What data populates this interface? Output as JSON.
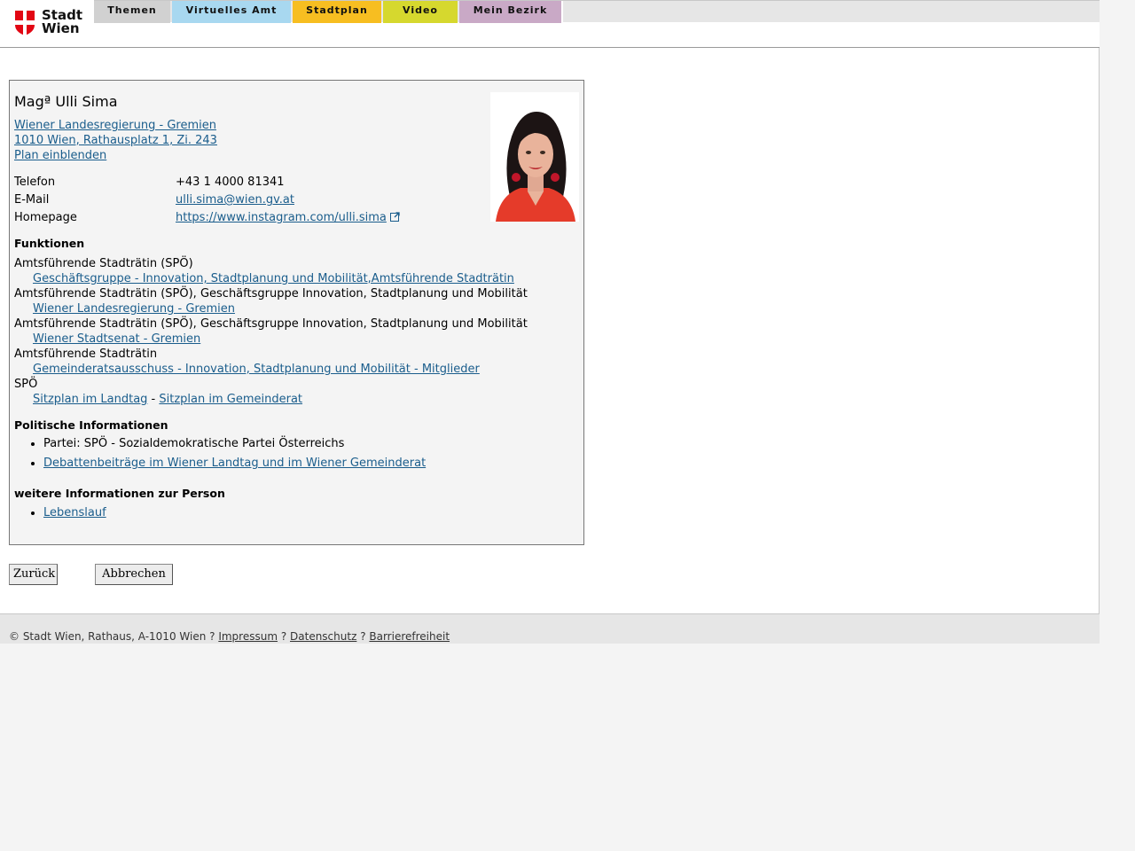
{
  "logo": {
    "line1": "Stadt",
    "line2": "Wien",
    "brand_color": "#e20613"
  },
  "nav": {
    "tabs": [
      {
        "label": "Themen",
        "color": "#d1d1d1"
      },
      {
        "label": "Virtuelles Amt",
        "color": "#a8d8f0"
      },
      {
        "label": "Stadtplan",
        "color": "#f7be21"
      },
      {
        "label": "Video",
        "color": "#d6d82e"
      },
      {
        "label": "Mein Bezirk",
        "color": "#c9a9c6"
      }
    ]
  },
  "person": {
    "name": "Magª Ulli Sima",
    "org_link": "Wiener Landesregierung - Gremien ",
    "address_link": "1010 Wien, Rathausplatz 1, Zi. 243",
    "plan_link": "Plan einblenden",
    "photo_icon": "portrait-photo"
  },
  "contact": {
    "phone_label": "Telefon",
    "phone": "+43 1 4000 81341",
    "email_label": "E-Mail",
    "email": "ulli.sima@wien.gv.at",
    "homepage_label": "Homepage",
    "homepage": "https://www.instagram.com/ulli.sima",
    "homepage_icon": "external-link-icon"
  },
  "functions": {
    "heading": "Funktionen",
    "items": [
      {
        "role": "Amtsführende Stadträtin (SPÖ)",
        "link": "Geschäftsgruppe - Innovation, Stadtplanung und Mobilität,Amtsführende Stadträtin"
      },
      {
        "role": "Amtsführende Stadträtin (SPÖ), Geschäftsgruppe Innovation, Stadtplanung und Mobilität",
        "link": "Wiener Landesregierung - Gremien"
      },
      {
        "role": "Amtsführende Stadträtin (SPÖ), Geschäftsgruppe Innovation, Stadtplanung und Mobilität",
        "link": "Wiener Stadtsenat - Gremien"
      },
      {
        "role": "Amtsführende Stadträtin",
        "link": "Gemeinderatsausschuss - Innovation, Stadtplanung und Mobilität - Mitglieder"
      }
    ],
    "party": "SPÖ",
    "seat_landtag": "Sitzplan im Landtag",
    "seat_sep": " - ",
    "seat_gemeinderat": "Sitzplan im Gemeinderat"
  },
  "political": {
    "heading": "Politische Informationen",
    "party_text": "Partei: SPÖ - Sozialdemokratische Partei Österreichs",
    "debate_link": "Debattenbeiträge im Wiener Landtag und im Wiener Gemeinderat"
  },
  "more": {
    "heading": "weitere Informationen zur Person",
    "cv_link": "Lebenslauf"
  },
  "buttons": {
    "back": "Zurück",
    "cancel": "Abbrechen"
  },
  "footer": {
    "copyright": "© Stadt Wien, Rathaus, A-1010 Wien ? ",
    "impressum": "Impressum",
    "sep1": " ? ",
    "datenschutz": "Datenschutz",
    "sep2": " ? ",
    "barrierefreiheit": "Barrierefreiheit"
  }
}
